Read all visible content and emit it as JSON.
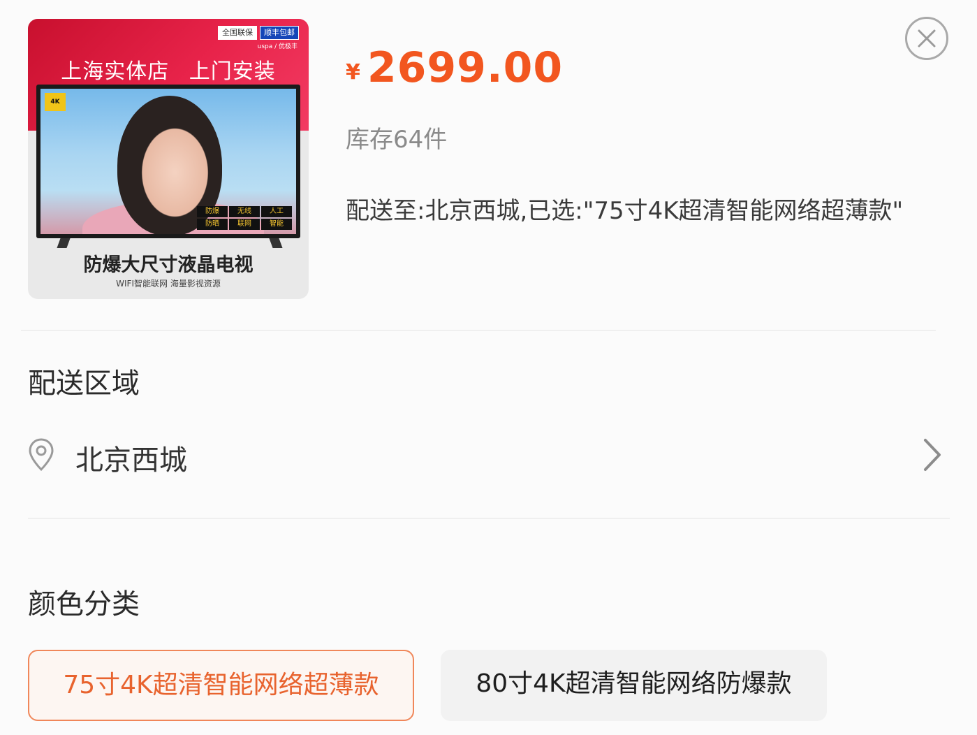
{
  "product_image": {
    "badges": [
      "全国联保",
      "顺丰包邮"
    ],
    "brand_mark": "uspa / 优极丰",
    "slogan": "上海实体店 上门安装",
    "screen_tag": "4K",
    "features": [
      "防爆",
      "无线",
      "人工",
      "防晒",
      "联网",
      "智能"
    ],
    "caption": "防爆大尺寸液晶电视",
    "subcaption": "WIFI智能联网 海量影视资源"
  },
  "price": {
    "symbol": "¥",
    "value": "2699.00",
    "color": "#f2561f"
  },
  "stock": "库存64件",
  "delivery_info": "配送至:北京西城,已选:\"75寸4K超清智能网络超薄款\"",
  "close_icon": "close-circle-icon",
  "delivery_area": {
    "title": "配送区域",
    "icon": "location-pin-icon",
    "value": "北京西城",
    "chevron": "chevron-right-icon"
  },
  "color_category": {
    "title": "颜色分类",
    "options": [
      {
        "label": "75寸4K超清智能网络超薄款",
        "selected": true
      },
      {
        "label": "80寸4K超清智能网络防爆款",
        "selected": false
      }
    ],
    "selected_color": "#e8632e"
  }
}
